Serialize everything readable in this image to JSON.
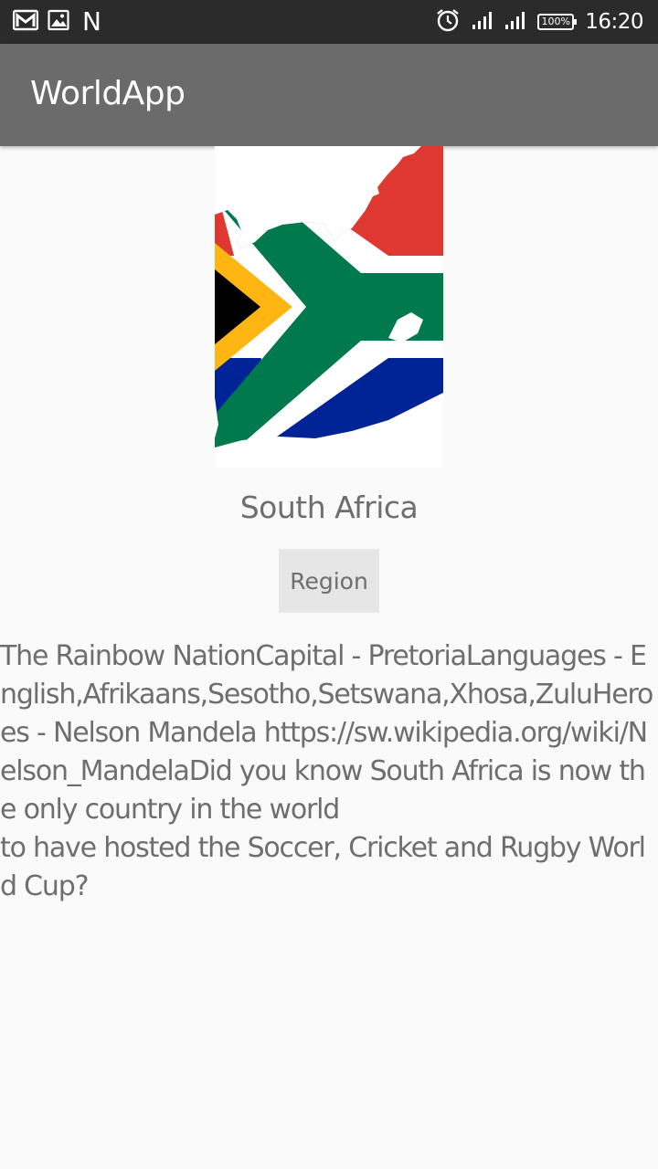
{
  "status_bar": {
    "time": "16:20",
    "battery": "100%",
    "notification_icons": [
      "gmail-icon",
      "image-icon",
      "n-icon"
    ],
    "system_icons": [
      "alarm-icon",
      "signal-icon",
      "signal-icon",
      "battery-icon"
    ],
    "n_label": "N"
  },
  "app_bar": {
    "title": "WorldApp",
    "background_color": "#6b6b6b"
  },
  "country": {
    "name": "South Africa",
    "flag_icon": "south-africa-flag-map-icon",
    "region_button_label": "Region",
    "description": "The Rainbow NationCapital - PretoriaLanguages - English,Afrikaans,Sesotho,Setswana,Xhosa,ZuluHeroes - Nelson Mandela https://sw.wikipedia.org/wiki/Nelson_MandelaDid you know South Africa is now the only country in the world\nto have hosted the Soccer, Cricket and Rugby World Cup?"
  }
}
